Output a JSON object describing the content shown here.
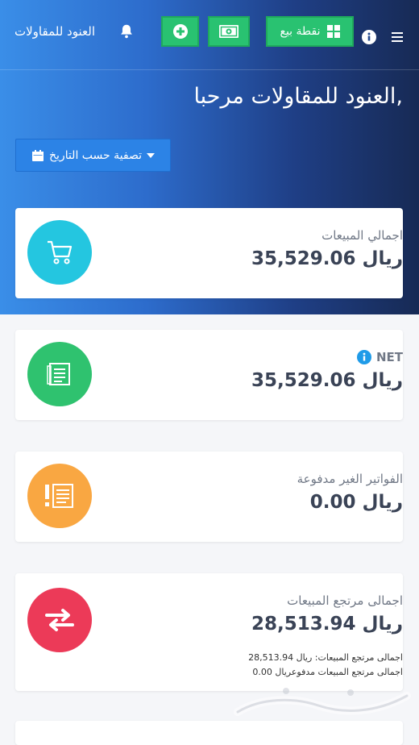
{
  "header": {
    "company_name": "العنود للمقاولات",
    "pos_button_label": "نقطة بيع"
  },
  "welcome": {
    "text": ",العنود للمقاولات مرحبا"
  },
  "filter": {
    "label": "تصفية حسب التاريخ"
  },
  "cards": [
    {
      "label": "اجمالي المبيعات",
      "value": "ريال 35,529.06",
      "color": "#24c6e0",
      "icon": "cart-icon"
    },
    {
      "label": "NET",
      "value": "ريال 35,529.06",
      "color": "#2fc26f",
      "icon": "invoice-list-icon"
    },
    {
      "label": "الفواتير الغير مدفوعة",
      "value": "ريال 0.00",
      "color": "#f9a742",
      "icon": "unpaid-invoice-icon"
    },
    {
      "label": "اجمالى مرتجع المبيعات",
      "value": "ريال 28,513.94",
      "color": "#ec3a58",
      "icon": "exchange-arrows-icon",
      "sub_lines": [
        "اجمالى مرتجع المبيعات: ريال 28,513.94",
        "اجمالى مرتجع المبيعات مدفوعريال 0.00"
      ]
    }
  ],
  "colors": {
    "accent_green": "#29c271",
    "filter_blue": "#2c83e6",
    "hero_start": "#3a8ee8",
    "hero_end": "#172a55"
  }
}
